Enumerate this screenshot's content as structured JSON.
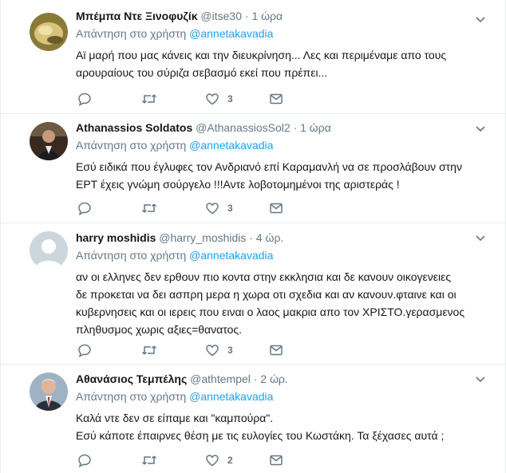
{
  "tweets": [
    {
      "name": "Μπέμπα Ντε Ξινοφυζίκ",
      "handle": "@itse30",
      "dot": "·",
      "time": "1 ώρα",
      "reply_prefix": "Απάντηση στο χρήστη",
      "reply_mention": "@annetakavadia",
      "lines": [
        "Αϊ μαρή που μας κάνεις και την διευκρίνηση... Λες και περιμέναμε απο τους",
        "αρουραίους του σύριζα σεβασμό εκεί που πρέπει..."
      ],
      "likes": "3"
    },
    {
      "name": "Athanassios Soldatos",
      "handle": "@AthanassiosSol2",
      "dot": "·",
      "time": "1 ώρα",
      "reply_prefix": "Απάντηση στο χρήστη",
      "reply_mention": "@annetakavadia",
      "lines": [
        "Εσύ ειδικά που έγλυφες τον Ανδριανό επί Καραμανλή να σε προσλάβουν στην",
        "ΕΡΤ έχεις γνώμη σούργελο !!!Αντε λοβοτομημένοι της αριστεράς !"
      ],
      "likes": "3"
    },
    {
      "name": "harry moshidis",
      "handle": "@harry_moshidis",
      "dot": "·",
      "time": "4 ώρ.",
      "reply_prefix": "Απάντηση στο χρήστη",
      "reply_mention": "@annetakavadia",
      "lines": [
        "αν οι ελληνες δεν ερθουν πιο κοντα στην εκκλησια και δε κανουν οικογενειες",
        "δε προκεται να δει ασπρη μερα η χωρα οτι σχεδια και αν κανουν.φταινε και οι",
        "κυβερνησεις και οι ιερεις που ειναι ο λαος μακρια απο τον ΧΡΙΣΤΟ.γερασμενος",
        "πληθυσμος χωρις αξιες=θανατος."
      ],
      "likes": "3"
    },
    {
      "name": "Αθανάσιος Τεμπέλης",
      "handle": "@athtempel",
      "dot": "·",
      "time": "2 ώρ.",
      "reply_prefix": "Απάντηση στο χρήστη",
      "reply_mention": "@annetakavadia",
      "lines": [
        "Καλά ντε δεν σε είπαμε και \"καμπούρα\".",
        "Εσύ κάποτε έπαιρνες θέση με τις ευλογίες του Κωστάκη. Τα ξέχασες αυτά ;"
      ],
      "likes": "2"
    }
  ],
  "colors": {
    "link": "#1da1f2",
    "secondary": "#657786",
    "text": "#14171a",
    "divider": "#e6ecf0"
  },
  "icons": [
    "reply-icon",
    "retweet-icon",
    "like-icon",
    "direct-message-icon",
    "chevron-down-icon"
  ]
}
